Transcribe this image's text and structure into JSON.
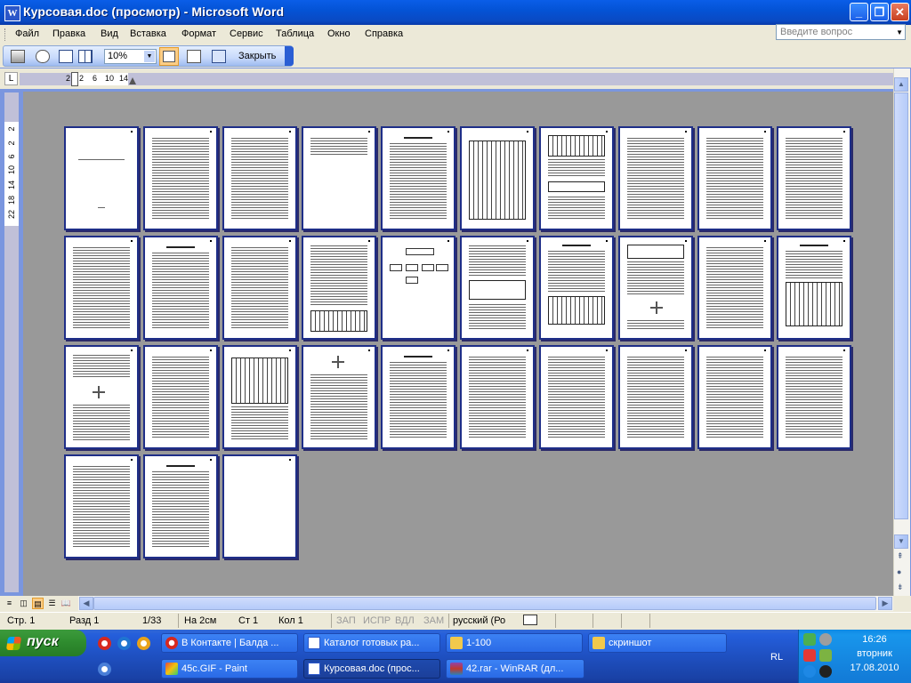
{
  "window": {
    "title": "Курсовая.doc (просмотр) - Microsoft Word",
    "app_icon": "word-icon",
    "controls": [
      "minimize",
      "maximize",
      "close"
    ]
  },
  "menu": {
    "items": [
      "Файл",
      "Правка",
      "Вид",
      "Вставка",
      "Формат",
      "Сервис",
      "Таблица",
      "Окно",
      "Справка"
    ],
    "ask_placeholder": "Введите вопрос"
  },
  "toolbar": {
    "zoom": "10%",
    "close_label": "Закрыть",
    "icons": [
      "print-icon",
      "magnifier-icon",
      "one-page-icon",
      "multiple-pages-icon",
      "view-ruler-icon",
      "shrink-to-fit-icon",
      "full-screen-icon"
    ]
  },
  "ruler": {
    "tab_marker": "L",
    "h_labels": [
      "2",
      "2",
      "6",
      "10",
      "14"
    ],
    "v_labels": [
      "2",
      "2",
      "6",
      "10",
      "14",
      "18",
      "22"
    ]
  },
  "document": {
    "page_count": 33,
    "columns": 10
  },
  "status": {
    "page": "Стр. 1",
    "section": "Разд 1",
    "pages": "1/33",
    "at": "На  2см",
    "line": "Ст  1",
    "col": "Кол  1",
    "rec": "ЗАП",
    "trk": "ИСПР",
    "ext": "ВДЛ",
    "ovr": "ЗАМ",
    "language": "русский (Ро"
  },
  "taskbar": {
    "start_label": "пуск",
    "tasks_row1": [
      {
        "label": "В Контакте | Балда ...",
        "icon": "opera-icon"
      },
      {
        "label": "Каталог готовых ра...",
        "icon": "word-doc-icon"
      },
      {
        "label": "1-100",
        "icon": "folder-icon"
      },
      {
        "label": "скриншот",
        "icon": "folder-icon"
      }
    ],
    "tasks_row2": [
      {
        "label": "45c.GIF - Paint",
        "icon": "paint-icon"
      },
      {
        "label": "Курсовая.doc (прос...",
        "icon": "word-doc-icon"
      },
      {
        "label": "42.rar - WinRAR (дл...",
        "icon": "winrar-icon"
      }
    ],
    "lang_indicator": "RL",
    "clock": {
      "time": "16:26",
      "day": "вторник",
      "date": "17.08.2010"
    }
  }
}
